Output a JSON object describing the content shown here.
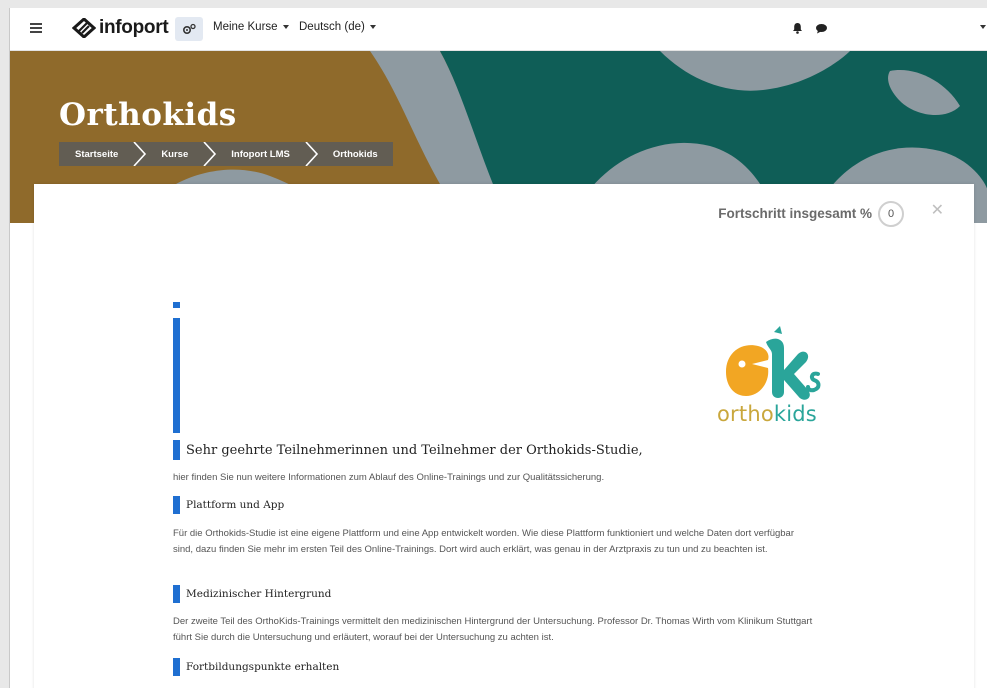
{
  "navbar": {
    "brand": "infoport",
    "menu_courses": "Meine Kurse",
    "menu_language": "Deutsch (de)"
  },
  "hero": {
    "title": "Orthokids",
    "breadcrumb": [
      "Startseite",
      "Kurse",
      "Infoport LMS",
      "Orthokids"
    ]
  },
  "progress": {
    "label": "Fortschritt insgesamt %",
    "value": "0"
  },
  "logo": {
    "text_a": "ortho",
    "text_b": "kids"
  },
  "content": {
    "heading": "Sehr geehrte Teilnehmerinnen und Teilnehmer der Orthokids-Studie,",
    "intro": "hier finden Sie nun weitere Informationen zum Ablauf des Online-Trainings und zur Qualitätssicherung.",
    "sections": [
      {
        "title": "Plattform und App",
        "text": "Für die Orthokids-Studie ist eine eigene Plattform und eine App entwickelt worden. Wie diese Plattform funktioniert und welche Daten dort verfügbar sind, dazu finden Sie mehr im ersten Teil des Online-Trainings. Dort wird auch erklärt, was genau in der Arztpraxis zu tun und zu beachten ist."
      },
      {
        "title": "Medizinischer Hintergrund",
        "text": "Der zweite Teil des OrthoKids-Trainings vermittelt den medizinischen Hintergrund der Untersuchung. Professor Dr. Thomas Wirth vom Klinikum Stuttgart führt Sie durch die Untersuchung und erläutert, worauf bei der Untersuchung zu achten ist."
      },
      {
        "title": "Fortbildungspunkte erhalten",
        "text": ""
      }
    ]
  },
  "colors": {
    "accent": "#1f6fd1",
    "hero_gold": "#8f6a2b",
    "hero_teal": "#0f5e57",
    "logo_orange": "#f2a623",
    "logo_teal": "#2aa59a"
  }
}
